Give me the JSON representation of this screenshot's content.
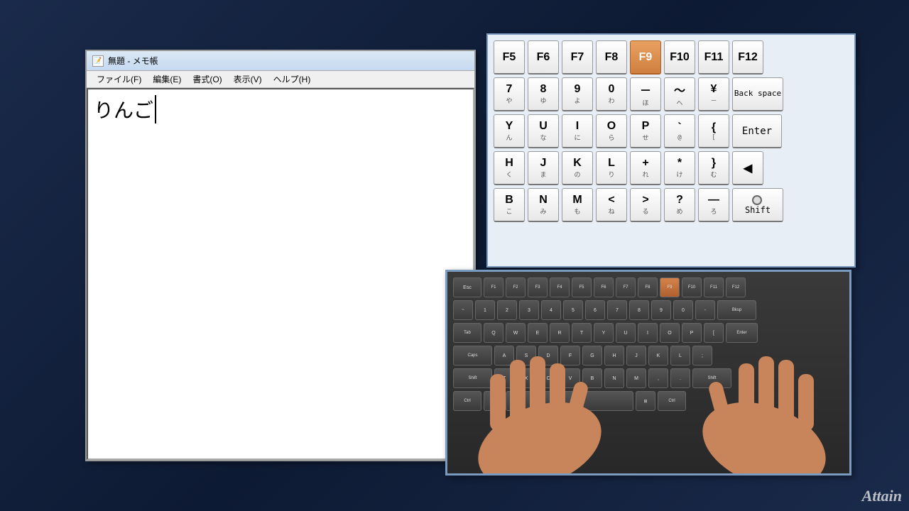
{
  "background": {
    "color1": "#1a2a4a",
    "color2": "#0d1a33"
  },
  "notepad": {
    "title": "無題 - メモ帳",
    "menu": {
      "file": "ファイル(F)",
      "edit": "編集(E)",
      "format": "書式(O)",
      "view": "表示(V)",
      "help": "ヘルプ(H)"
    },
    "content": "りんご"
  },
  "vkeyboard": {
    "rows": [
      {
        "keys": [
          {
            "label": "F5",
            "sub": ""
          },
          {
            "label": "F6",
            "sub": ""
          },
          {
            "label": "F7",
            "sub": ""
          },
          {
            "label": "F8",
            "sub": ""
          },
          {
            "label": "F9",
            "sub": "",
            "active": true
          },
          {
            "label": "F10",
            "sub": ""
          },
          {
            "label": "F11",
            "sub": ""
          },
          {
            "label": "F12",
            "sub": ""
          }
        ]
      },
      {
        "keys": [
          {
            "label": "7",
            "sub": "や"
          },
          {
            "label": "8",
            "sub": "ゆ"
          },
          {
            "label": "9",
            "sub": "よ"
          },
          {
            "label": "0",
            "sub": "わ"
          },
          {
            "label": "－",
            "sub": "ほ"
          },
          {
            "label": "～",
            "sub": "へ"
          },
          {
            "label": "¥",
            "sub": "－"
          },
          {
            "label": "Back space",
            "sub": "",
            "wide": true,
            "backspace": true
          }
        ]
      },
      {
        "keys": [
          {
            "label": "Y",
            "sub": "ん"
          },
          {
            "label": "U",
            "sub": "な"
          },
          {
            "label": "I",
            "sub": "に"
          },
          {
            "label": "O",
            "sub": "ら"
          },
          {
            "label": "P",
            "sub": "せ"
          },
          {
            "label": "@",
            "sub": "゛"
          },
          {
            "label": "[",
            "sub": "゜"
          },
          {
            "label": "Enter",
            "sub": "",
            "enter": true
          }
        ]
      },
      {
        "keys": [
          {
            "label": "H",
            "sub": "く"
          },
          {
            "label": "J",
            "sub": "ま"
          },
          {
            "label": "K",
            "sub": "の"
          },
          {
            "label": "L",
            "sub": "り"
          },
          {
            "label": "+",
            "sub": "れ"
          },
          {
            "label": "*",
            "sub": "け"
          },
          {
            "label": "}",
            "sub": "む"
          },
          {
            "label": "←",
            "sub": "",
            "arrow": true
          }
        ]
      },
      {
        "keys": [
          {
            "label": "B",
            "sub": "こ"
          },
          {
            "label": "N",
            "sub": "み"
          },
          {
            "label": "M",
            "sub": "も"
          },
          {
            "label": "<",
            "sub": "ね"
          },
          {
            "label": ">",
            "sub": "る"
          },
          {
            "label": "?",
            "sub": "め"
          },
          {
            "label": "—",
            "sub": "ろ"
          },
          {
            "label": "Shift",
            "sub": "",
            "shift": true
          }
        ]
      }
    ]
  },
  "logo": {
    "text": "Attain"
  }
}
